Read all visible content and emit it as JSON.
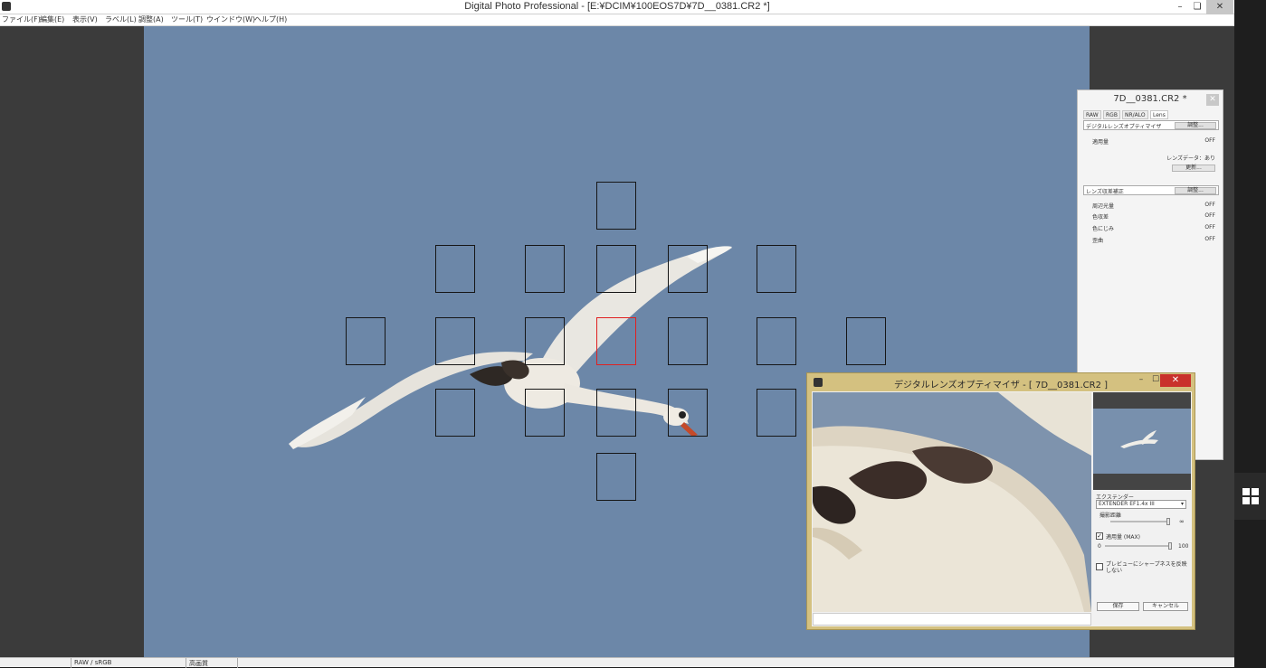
{
  "window": {
    "title": "Digital Photo Professional - [E:¥DCIM¥100EOS7D¥7D__0381.CR2 *]",
    "minimize_glyph": "–",
    "restore_glyph": "❏",
    "close_glyph": "✕"
  },
  "menu": {
    "items": [
      "ファイル(F)",
      "編集(E)",
      "表示(V)",
      "ラベル(L)",
      "調整(A)",
      "ツール(T)",
      "ウインドウ(W)",
      "ヘルプ(H)"
    ]
  },
  "status_bar": {
    "color_info": "RAW / sRGB",
    "quality": "高画質"
  },
  "tool_palette": {
    "title": "7D__0381.CR2 *",
    "close_glyph": "✕",
    "tabs": [
      "RAW",
      "RGB",
      "NR/ALO",
      "Lens"
    ],
    "active_tab": "Lens",
    "dlo_section": {
      "label": "デジタルレンズオプティマイザ",
      "adjust_button": "調整...",
      "amount_label": "適用量",
      "amount_value": "OFF",
      "lens_data": "レンズデータ：あり",
      "update_button": "更新..."
    },
    "aberration_section": {
      "label": "レンズ収差補正",
      "adjust_button": "調整...",
      "rows": [
        {
          "label": "周辺光量",
          "value": "OFF"
        },
        {
          "label": "色収差",
          "value": "OFF"
        },
        {
          "label": "色にじみ",
          "value": "OFF"
        },
        {
          "label": "歪曲",
          "value": "OFF"
        }
      ]
    }
  },
  "dlo_dialog": {
    "title": "デジタルレンズオプティマイザ - [ 7D__0381.CR2 ]",
    "minimize_glyph": "–",
    "maximize_glyph": "☐",
    "close_glyph": "✕",
    "extender_label": "エクステンダー",
    "extender_value": "EXTENDER EF1.4x III",
    "distance_label": "撮影距離",
    "infinity_glyph": "∞",
    "amount_checkbox_label": "適用量 (MAX)",
    "amount_checked": true,
    "amount_min": "0",
    "amount_max": "100",
    "sharpness_checkbox_label": "プレビューにシャープネスを反映しない",
    "sharpness_checked": false,
    "save_button": "保存",
    "cancel_button": "キャンセル"
  },
  "af_points": {
    "selected_index": 9
  }
}
